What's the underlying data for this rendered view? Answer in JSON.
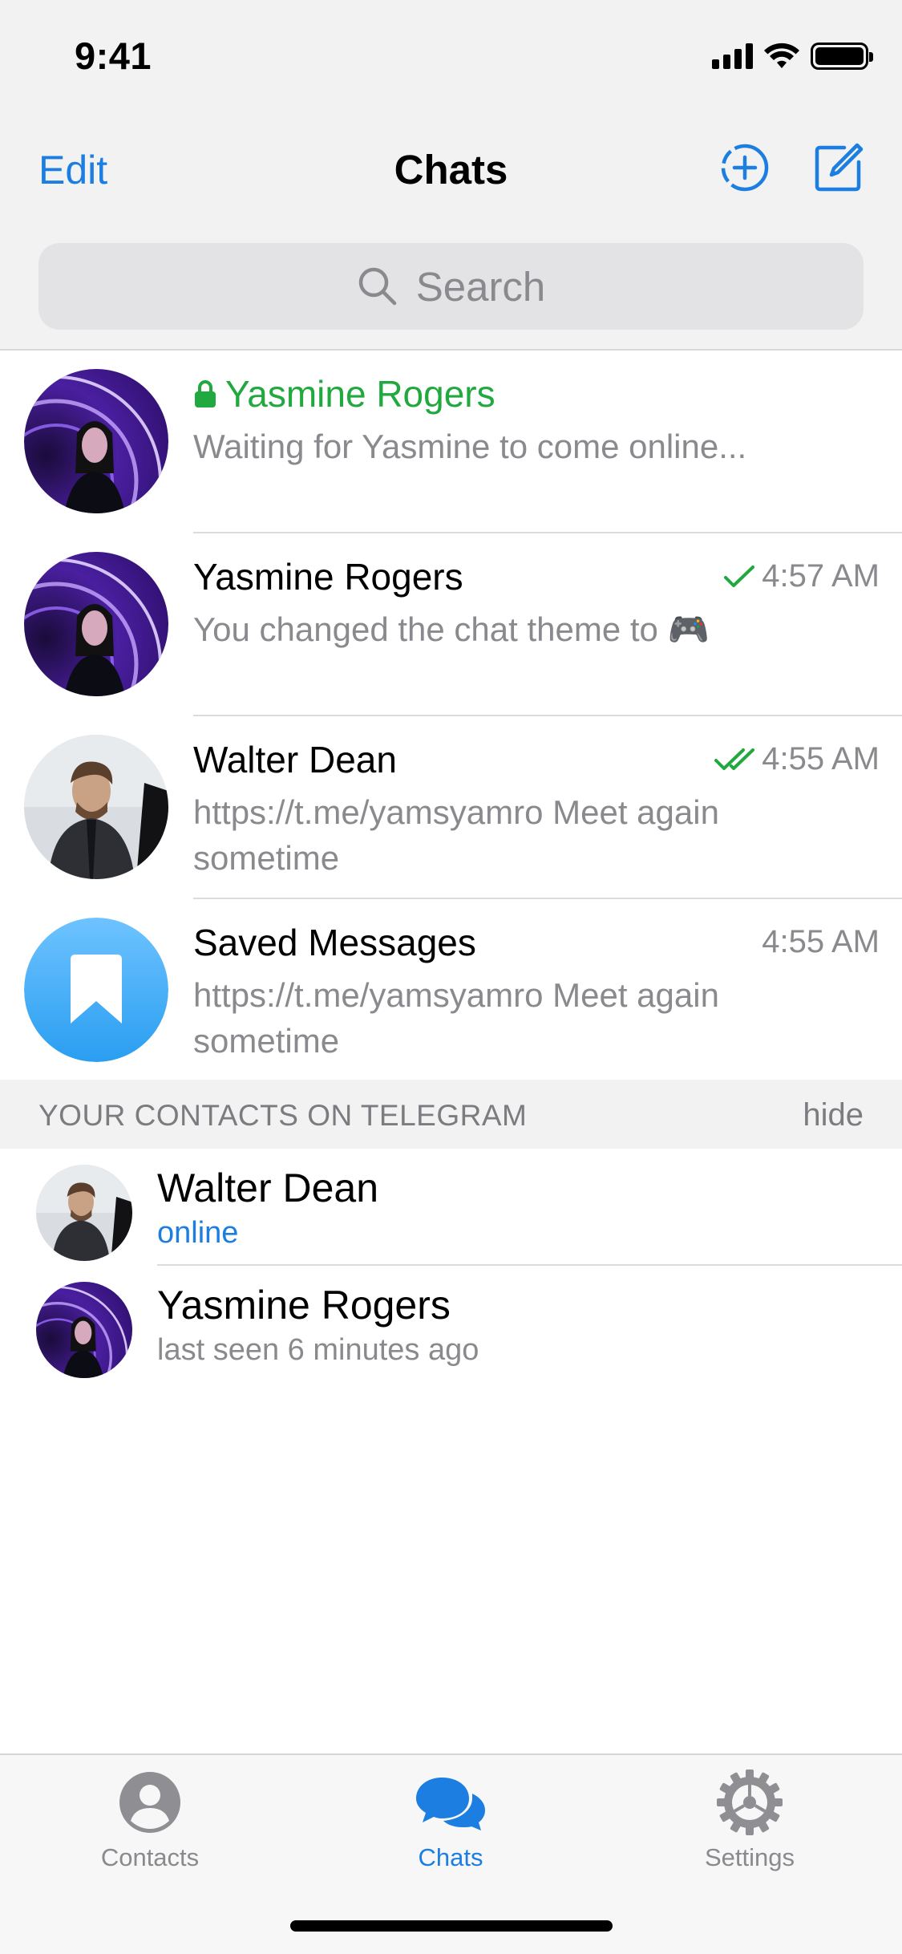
{
  "status_bar": {
    "time": "9:41"
  },
  "nav": {
    "edit_label": "Edit",
    "title": "Chats"
  },
  "search": {
    "placeholder": "Search"
  },
  "chats": [
    {
      "name": "Yasmine Rogers",
      "preview": "Waiting for Yasmine to come online...",
      "time": "",
      "secret": true
    },
    {
      "name": "Yasmine Rogers",
      "preview": "You changed the chat theme to 🎮",
      "time": "4:57 AM",
      "status": "sent"
    },
    {
      "name": "Walter Dean",
      "preview": "https://t.me/yamsyamro Meet again sometime",
      "time": "4:55 AM",
      "status": "read"
    },
    {
      "name": "Saved Messages",
      "preview": "https://t.me/yamsyamro Meet again sometime",
      "time": "4:55 AM"
    }
  ],
  "contacts_section": {
    "title": "YOUR CONTACTS ON TELEGRAM",
    "hide_label": "hide",
    "items": [
      {
        "name": "Walter Dean",
        "status": "online"
      },
      {
        "name": "Yasmine Rogers",
        "status": "last seen 6 minutes ago"
      }
    ]
  },
  "tabs": [
    {
      "label": "Contacts",
      "icon": "person-circle-icon"
    },
    {
      "label": "Chats",
      "icon": "chat-bubbles-icon",
      "active": true
    },
    {
      "label": "Settings",
      "icon": "gear-icon"
    }
  ],
  "colors": {
    "accent": "#1b7ee0",
    "secret_green": "#21a83f",
    "check_green": "#21a83f",
    "secondary_text": "#8a8a8e"
  }
}
